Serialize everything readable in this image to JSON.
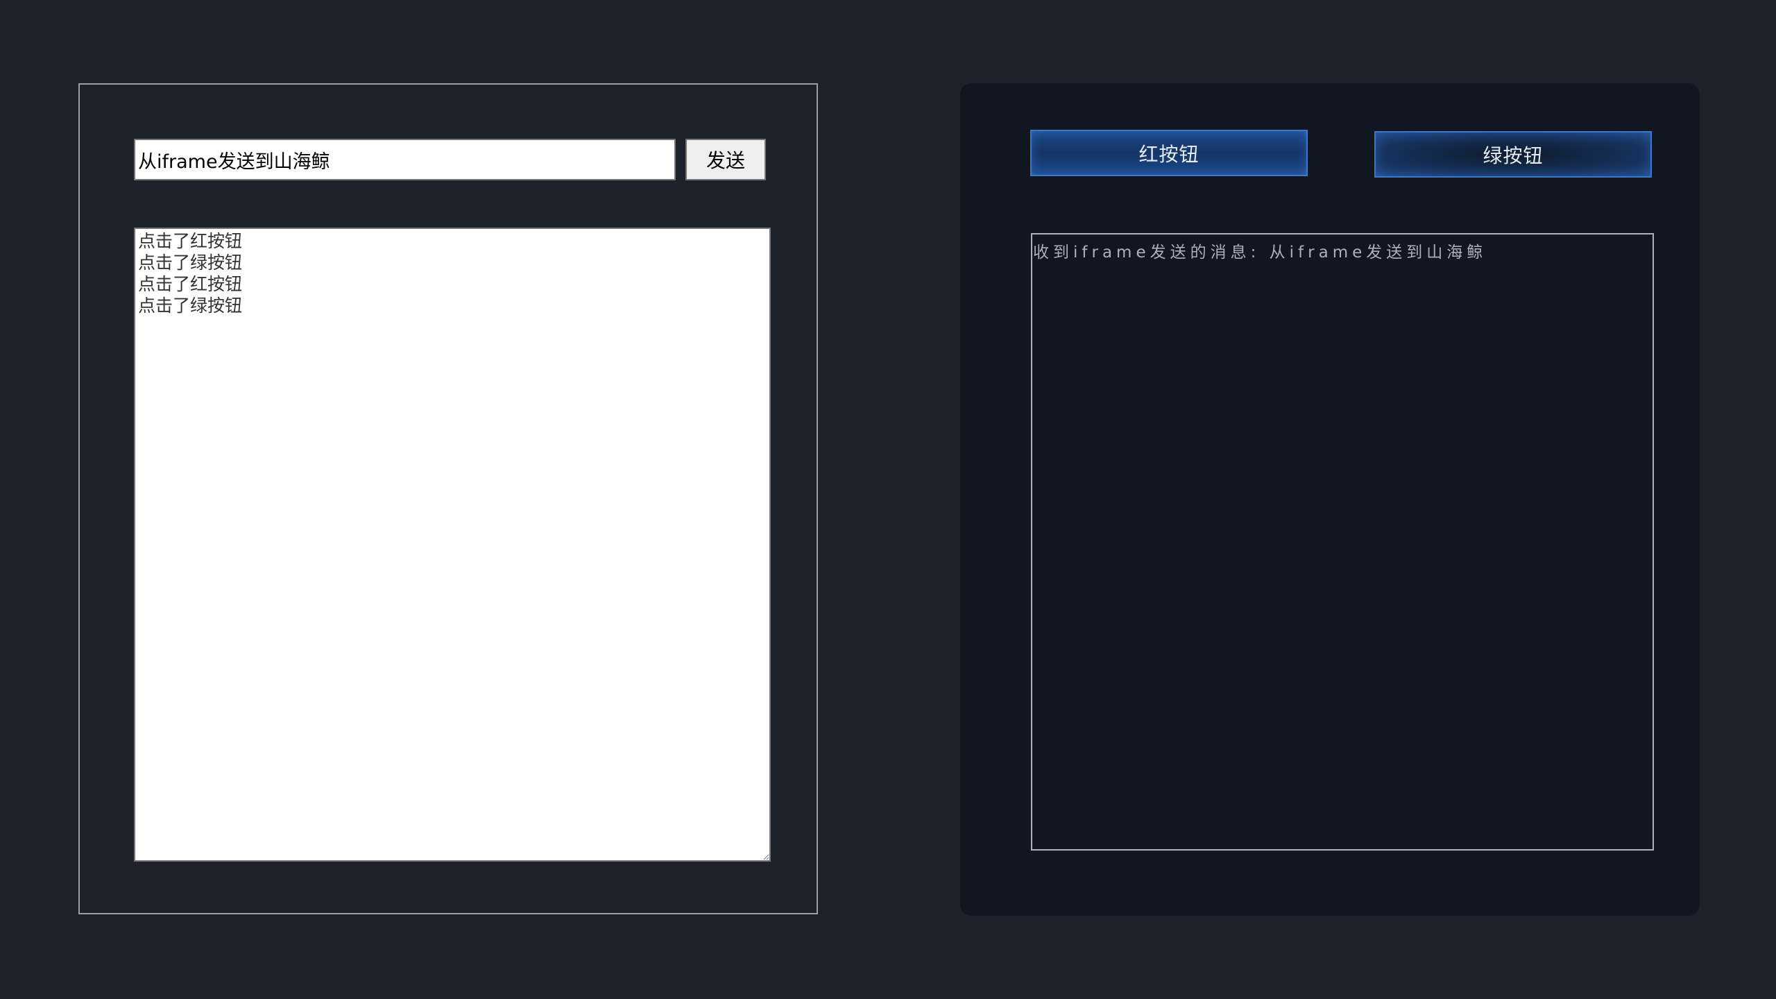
{
  "iframe_panel": {
    "message_input_value": "从iframe发送到山海鲸",
    "send_label": "发送",
    "log_text": "点击了红按钮\n点击了绿按钮\n点击了红按钮\n点击了绿按钮"
  },
  "host_panel": {
    "red_button_label": "红按钮",
    "green_button_label": "绿按钮",
    "received_message": "收到iframe发送的消息: 从iframe发送到山海鲸"
  },
  "colors": {
    "background": "#1d222a",
    "panel_dark": "#121621",
    "button_border": "#3a78c8"
  }
}
